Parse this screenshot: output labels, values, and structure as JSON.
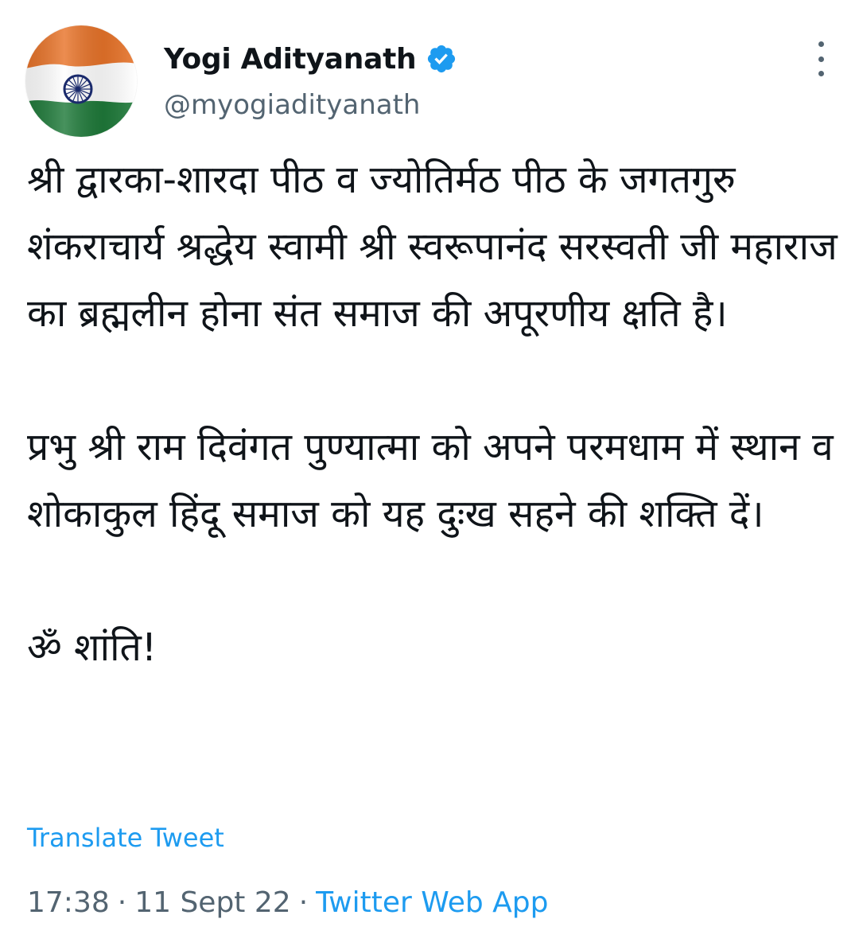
{
  "author": {
    "display_name": "Yogi Adityanath",
    "handle": "@myogiadityanath",
    "verified": true,
    "avatar_icon": "indian-flag-avatar"
  },
  "tweet": {
    "paragraphs": [
      "श्री द्वारका-शारदा पीठ व ज्योतिर्मठ पीठ के जगतगुरु शंकराचार्य श्रद्धेय स्वामी श्री स्वरूपानंद सरस्वती जी महाराज का ब्रह्मलीन होना संत समाज की अपूरणीय क्षति है।",
      "प्रभु श्री राम दिवंगत पुण्यात्मा को अपने परमधाम में स्थान व शोकाकुल हिंदू समाज को यह दुःख सहने की शक्ति दें।",
      "ॐ शांति!"
    ],
    "translate_label": "Translate Tweet",
    "time": "17:38",
    "date": "11 Sept 22",
    "source": "Twitter Web App",
    "separator": "·"
  },
  "colors": {
    "accent": "#1d9bf0",
    "secondary_text": "#536471",
    "primary_text": "#0f1419",
    "flag_saffron": "#e8742a",
    "flag_green": "#1f7a3a",
    "chakra_navy": "#1a2a6c"
  }
}
